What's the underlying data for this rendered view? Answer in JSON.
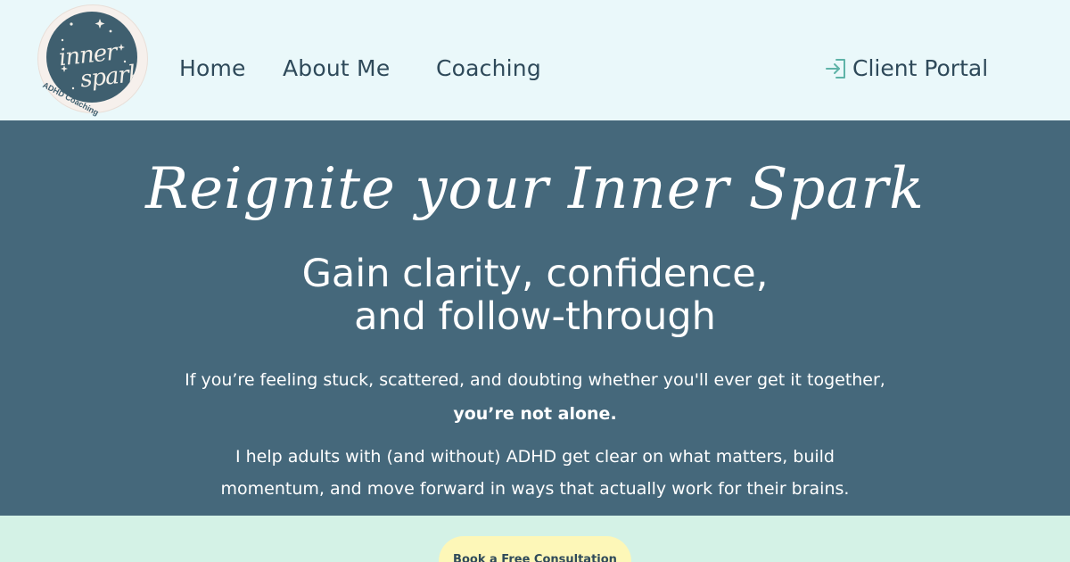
{
  "logo": {
    "line1": "inner",
    "line2": "spark",
    "tagline": "ADHD Coaching"
  },
  "nav": {
    "items": [
      {
        "label": "Home"
      },
      {
        "label": "About Me"
      },
      {
        "label": "Coaching"
      }
    ],
    "portal": {
      "label": "Client Portal",
      "icon": "login-icon"
    }
  },
  "hero": {
    "script_title": "Reignite your Inner Spark",
    "headline_line1": "Gain clarity, confidence,",
    "headline_line2": "and follow-through",
    "paragraph1": "If you’re feeling stuck, scattered, and doubting whether you'll ever get it together,",
    "paragraph2_bold": "you’re not alone.",
    "paragraph3_line1": "I help adults with (and without) ADHD get clear on what matters, build",
    "paragraph3_line2": "momentum, and move forward in ways that actually work for their brains."
  },
  "cta": {
    "label": "Book a Free Consultation"
  },
  "colors": {
    "header_bg": "#eaf8fa",
    "hero_bg": "#45687b",
    "band_bg": "#d4f2e6",
    "cta_bg": "#fdf7b8",
    "nav_text": "#2f4a5a",
    "icon_accent": "#5fb3a8"
  }
}
